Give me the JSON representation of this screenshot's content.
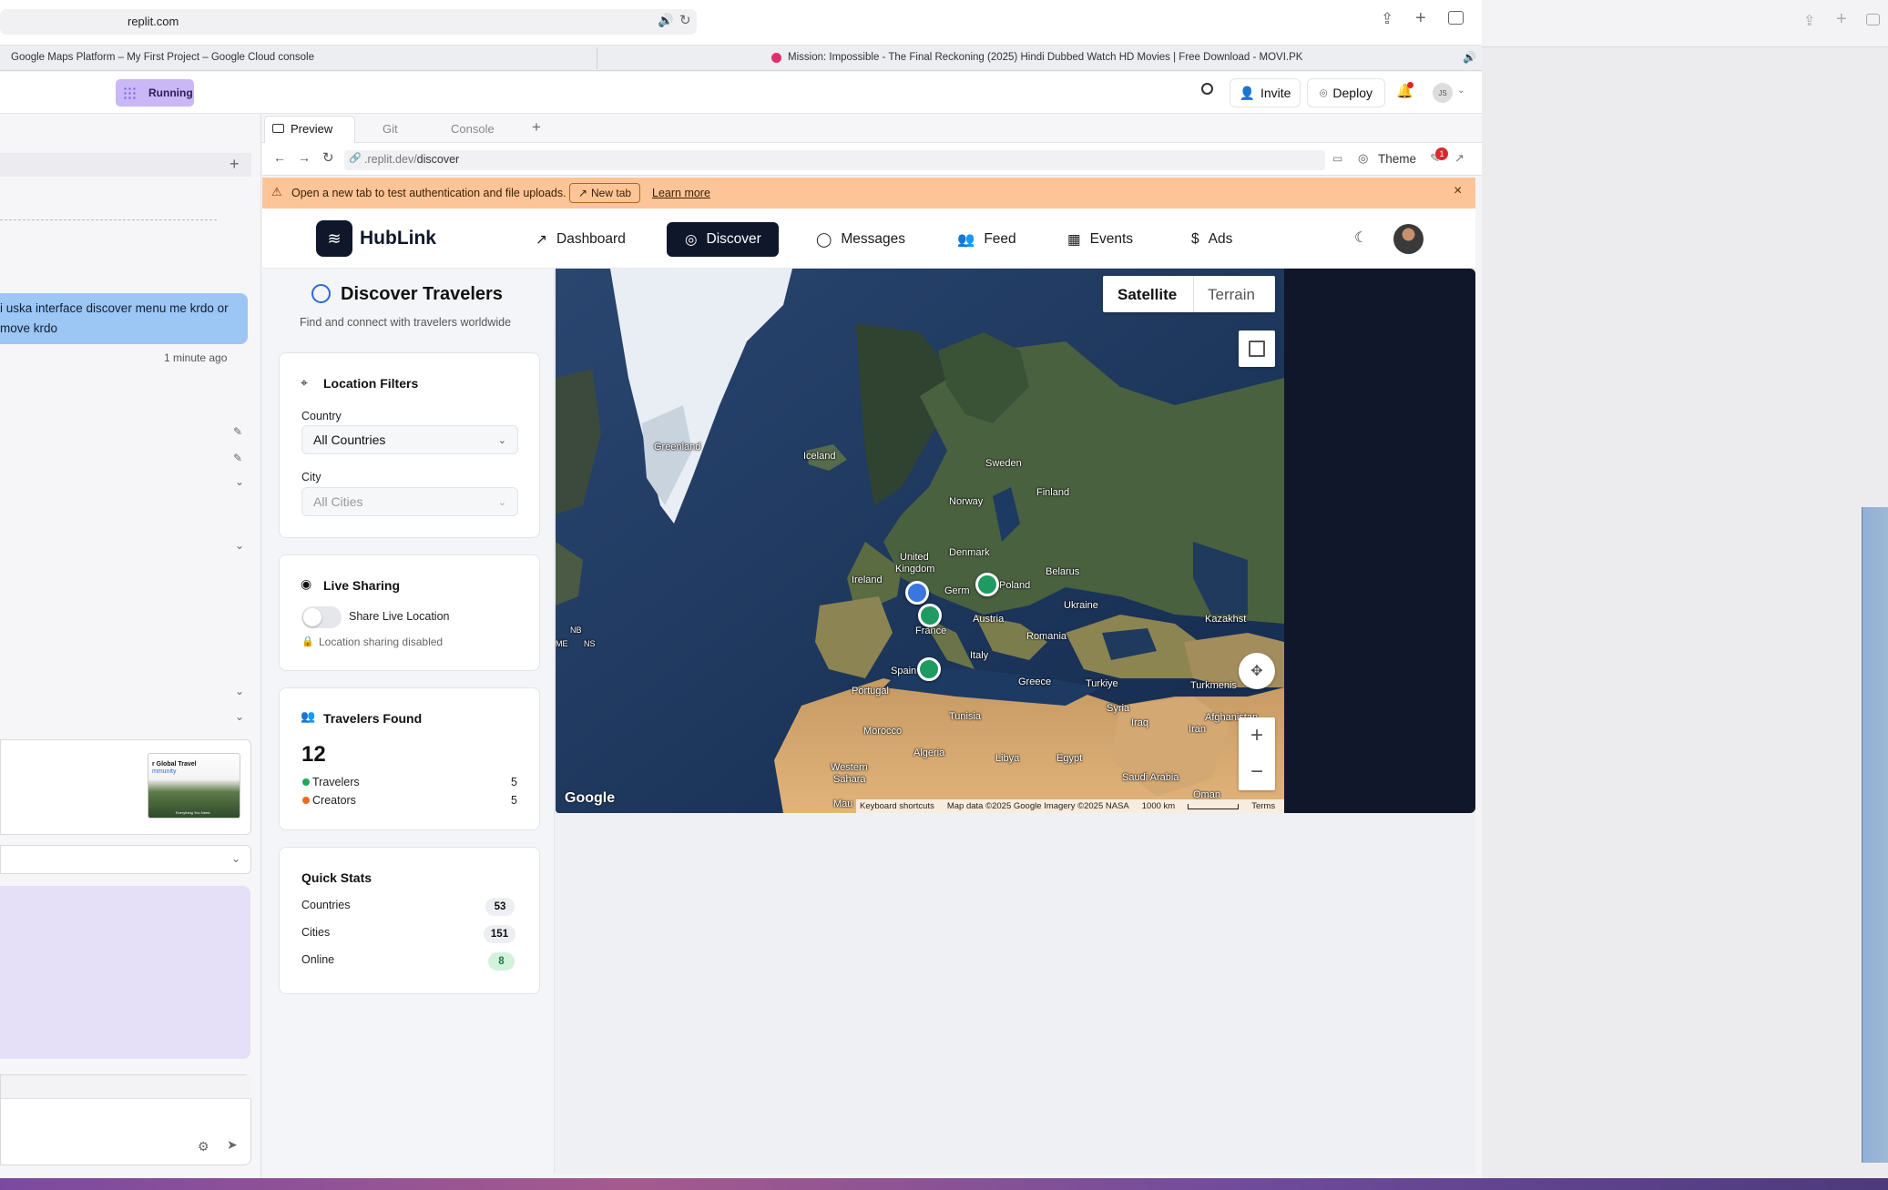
{
  "browser": {
    "url": "replit.com",
    "tabs": [
      "Google Maps Platform – My First Project – Google Cloud console",
      "Mission: Impossible - The Final Reckoning (2025) Hindi Dubbed Watch HD Movies | Free Download - MOVI.PK"
    ]
  },
  "replit": {
    "status": "Running",
    "invite_label": "Invite",
    "deploy_label": "Deploy",
    "avatar_initials": "JS"
  },
  "chat": {
    "message_line1": "i uska interface discover menu me krdo or",
    "message_line2": "move krdo",
    "time": "1 minute ago",
    "thumb_title": "r Global Travel",
    "thumb_sub": "mmunity",
    "thumb_foot": "Everything You Need"
  },
  "preview": {
    "tabs": [
      "Preview",
      "Git",
      "Console"
    ],
    "address_prefix": ".replit.dev/",
    "address_path": "discover",
    "theme_label": "Theme",
    "notif_count": "1",
    "banner_text": "Open a new tab to test authentication and file uploads.",
    "banner_newtab": "New tab",
    "banner_learn": "Learn more"
  },
  "app": {
    "brand": "HubLink",
    "nav": [
      "Dashboard",
      "Discover",
      "Messages",
      "Feed",
      "Events",
      "Ads"
    ]
  },
  "discover": {
    "title": "Discover Travelers",
    "subtitle": "Find and connect with travelers worldwide",
    "filters": {
      "title": "Location Filters",
      "country_label": "Country",
      "country_value": "All Countries",
      "city_label": "City",
      "city_value": "All Cities"
    },
    "live": {
      "title": "Live Sharing",
      "toggle_label": "Share Live Location",
      "status": "Location sharing disabled",
      "enabled": false
    },
    "found": {
      "title": "Travelers Found",
      "count": "12",
      "rows": [
        {
          "label": "Travelers",
          "value": "5",
          "color": "#22a55b"
        },
        {
          "label": "Creators",
          "value": "5",
          "color": "#f06a1e"
        }
      ]
    },
    "stats": {
      "title": "Quick Stats",
      "rows": [
        {
          "label": "Countries",
          "value": "53"
        },
        {
          "label": "Cities",
          "value": "151"
        },
        {
          "label": "Online",
          "value": "8"
        }
      ]
    }
  },
  "map": {
    "type_buttons": [
      "Satellite",
      "Terrain"
    ],
    "selected": "Satellite",
    "labels": [
      "Greenland",
      "Iceland",
      "Sweden",
      "Norway",
      "Finland",
      "United",
      "Kingdom",
      "Denmark",
      "Ireland",
      "Belarus",
      "Poland",
      "Germ",
      "France",
      "Austria",
      "Ukraine",
      "Romania",
      "Italy",
      "Spain",
      "Portugal",
      "Greece",
      "Turkiye",
      "Kazakhst",
      "Turkmenis",
      "Syria",
      "Iraq",
      "Iran",
      "Tunisia",
      "Morocco",
      "Algeria",
      "Libya",
      "Egypt",
      "Saudi Arabia",
      "Oman",
      "Western",
      "Sahara",
      "Afghanistan",
      "NB",
      "NS",
      "ME",
      "Mau"
    ],
    "attribution": "Map data ©2025 Google Imagery ©2025 NASA",
    "shortcuts": "Keyboard shortcuts",
    "scale": "1000 km",
    "terms": "Terms",
    "logo": "Google"
  }
}
